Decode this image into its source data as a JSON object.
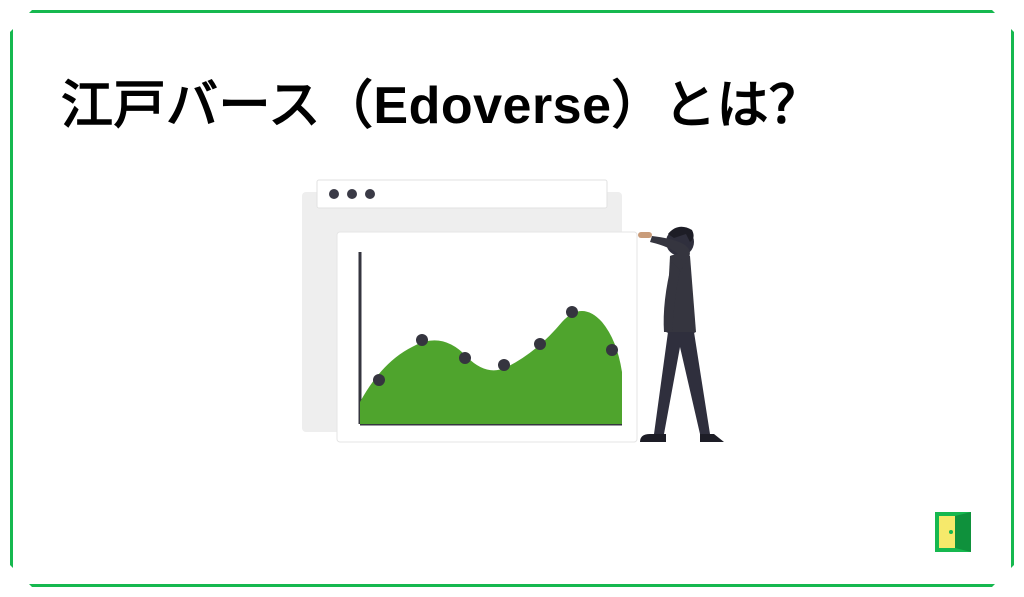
{
  "title": "江戸バース（Edoverse）とは？",
  "illustration": {
    "browser_dots": 3,
    "chart": {
      "fill": "#4fa42d",
      "points": 7
    },
    "person": "person-looking-at-chart"
  },
  "logo": {
    "name": "door-icon",
    "green": "#16b84f",
    "yellow": "#f6e96b"
  },
  "border_color": "#16b84f"
}
